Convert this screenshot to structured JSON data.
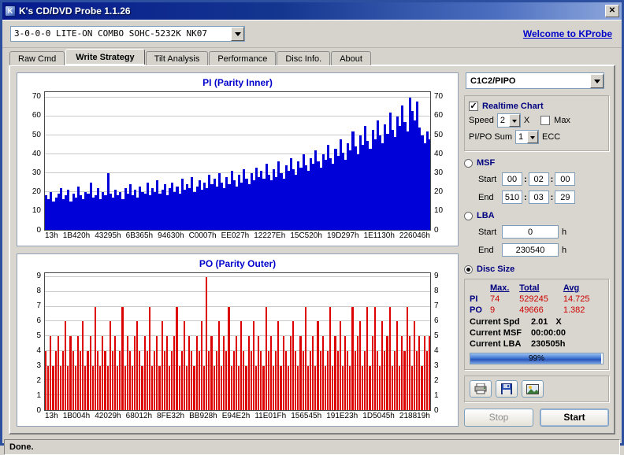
{
  "window": {
    "title": "K's CD/DVD Probe 1.1.26",
    "close_label": "✕",
    "icon_label": "K"
  },
  "toolbar": {
    "drive_selector": "3-0-0-0 LITE-ON COMBO SOHC-5232K NK07",
    "welcome_link": "Welcome to KProbe"
  },
  "tabs": [
    {
      "label": "Raw Cmd"
    },
    {
      "label": "Write Strategy"
    },
    {
      "label": "Tilt Analysis"
    },
    {
      "label": "Performance"
    },
    {
      "label": "Disc Info."
    },
    {
      "label": "About"
    }
  ],
  "controls": {
    "mode_selector": "C1C2/PIPO",
    "realtime_chart_label": "Realtime Chart",
    "realtime_checked": "✓",
    "speed_label": "Speed",
    "speed_value": "2",
    "speed_unit": "X",
    "max_label": "Max",
    "pipo_sum_label": "PI/PO Sum",
    "pipo_sum_value": "1",
    "ecc_label": "ECC",
    "msf": {
      "label": "MSF",
      "start_label": "Start",
      "end_label": "End",
      "start": [
        "00",
        "02",
        "00"
      ],
      "end": [
        "510",
        "03",
        "29"
      ]
    },
    "lba": {
      "label": "LBA",
      "start_label": "Start",
      "end_label": "End",
      "start": "0",
      "end": "230540",
      "unit": "h"
    },
    "disc_size_label": "Disc Size"
  },
  "stats": {
    "headers": [
      "Max.",
      "Total",
      "Avg"
    ],
    "rows": [
      {
        "name": "PI",
        "max": "74",
        "total": "529245",
        "avg": "14.725"
      },
      {
        "name": "PO",
        "max": "9",
        "total": "49666",
        "avg": "1.382"
      }
    ],
    "current_spd_label": "Current Spd",
    "current_spd": "2.01",
    "current_spd_unit": "X",
    "current_msf_label": "Current MSF",
    "current_msf": "00:00:00",
    "current_lba_label": "Current LBA",
    "current_lba": "230505h",
    "progress_text": "99%",
    "progress_value": 99
  },
  "actions": {
    "stop_label": "Stop",
    "start_label": "Start"
  },
  "status_bar": {
    "text": "Done."
  },
  "chart_data": [
    {
      "id": "pi",
      "type": "bar",
      "title": "PI (Parity Inner)",
      "color": "#0000d8",
      "ylim": [
        0,
        73
      ],
      "yticks": [
        0,
        10,
        20,
        30,
        40,
        50,
        60,
        70
      ],
      "xlabels": [
        "13h",
        "1B420h",
        "43295h",
        "6B365h",
        "94630h",
        "C0007h",
        "EE027h",
        "12227Eh",
        "15C520h",
        "19D297h",
        "1E1130h",
        "226046h"
      ],
      "bar_gap": 0,
      "values": [
        18,
        16,
        20,
        15,
        17,
        19,
        22,
        16,
        18,
        21,
        15,
        19,
        17,
        23,
        18,
        16,
        20,
        19,
        25,
        17,
        18,
        22,
        16,
        20,
        18,
        30,
        19,
        17,
        21,
        18,
        20,
        16,
        22,
        19,
        24,
        18,
        21,
        17,
        23,
        20,
        19,
        25,
        18,
        22,
        20,
        26,
        19,
        21,
        24,
        18,
        22,
        25,
        20,
        23,
        19,
        27,
        21,
        24,
        22,
        28,
        20,
        23,
        26,
        21,
        25,
        22,
        29,
        24,
        27,
        23,
        30,
        25,
        22,
        28,
        24,
        31,
        26,
        23,
        29,
        25,
        32,
        27,
        24,
        30,
        26,
        33,
        28,
        31,
        27,
        35,
        29,
        26,
        32,
        28,
        36,
        30,
        27,
        34,
        31,
        38,
        32,
        29,
        36,
        33,
        40,
        34,
        31,
        38,
        35,
        42,
        36,
        33,
        40,
        37,
        45,
        38,
        35,
        43,
        39,
        48,
        41,
        37,
        46,
        42,
        52,
        44,
        40,
        50,
        45,
        55,
        47,
        43,
        53,
        48,
        58,
        50,
        46,
        56,
        51,
        62,
        53,
        49,
        60,
        55,
        66,
        57,
        52,
        70,
        63,
        58,
        68,
        54,
        50,
        46,
        52,
        48
      ]
    },
    {
      "id": "po",
      "type": "bar",
      "title": "PO (Parity Outer)",
      "color": "#dd0000",
      "ylim": [
        0,
        9.3
      ],
      "yticks": [
        0,
        1,
        2,
        3,
        4,
        5,
        6,
        7,
        8,
        9
      ],
      "xlabels": [
        "13h",
        "1B004h",
        "42029h",
        "68012h",
        "8FE32h",
        "BB928h",
        "E94E2h",
        "11E01Fh",
        "156545h",
        "191E23h",
        "1D5045h",
        "218819h"
      ],
      "bar_gap": 1,
      "values": [
        4,
        3,
        5,
        3,
        4,
        5,
        3,
        4,
        6,
        3,
        5,
        4,
        3,
        5,
        4,
        6,
        3,
        4,
        5,
        3,
        7,
        4,
        3,
        5,
        4,
        3,
        6,
        4,
        5,
        3,
        4,
        7,
        3,
        5,
        4,
        3,
        5,
        6,
        4,
        3,
        5,
        4,
        7,
        3,
        4,
        5,
        3,
        6,
        4,
        5,
        3,
        4,
        5,
        7,
        3,
        4,
        6,
        3,
        5,
        4,
        3,
        5,
        4,
        6,
        3,
        9,
        4,
        5,
        3,
        4,
        6,
        3,
        5,
        4,
        7,
        3,
        4,
        5,
        3,
        6,
        4,
        3,
        5,
        4,
        6,
        3,
        5,
        4,
        3,
        7,
        4,
        5,
        3,
        4,
        6,
        3,
        5,
        4,
        3,
        5,
        6,
        4,
        3,
        5,
        4,
        7,
        3,
        4,
        5,
        3,
        6,
        4,
        5,
        3,
        4,
        7,
        3,
        5,
        4,
        6,
        3,
        5,
        4,
        3,
        7,
        4,
        5,
        6,
        3,
        4,
        7,
        3,
        5,
        7,
        4,
        3,
        6,
        4,
        5,
        7,
        3,
        4,
        6,
        3,
        5,
        4,
        7,
        5,
        3,
        6,
        4,
        5,
        3,
        5,
        4,
        5
      ]
    }
  ]
}
